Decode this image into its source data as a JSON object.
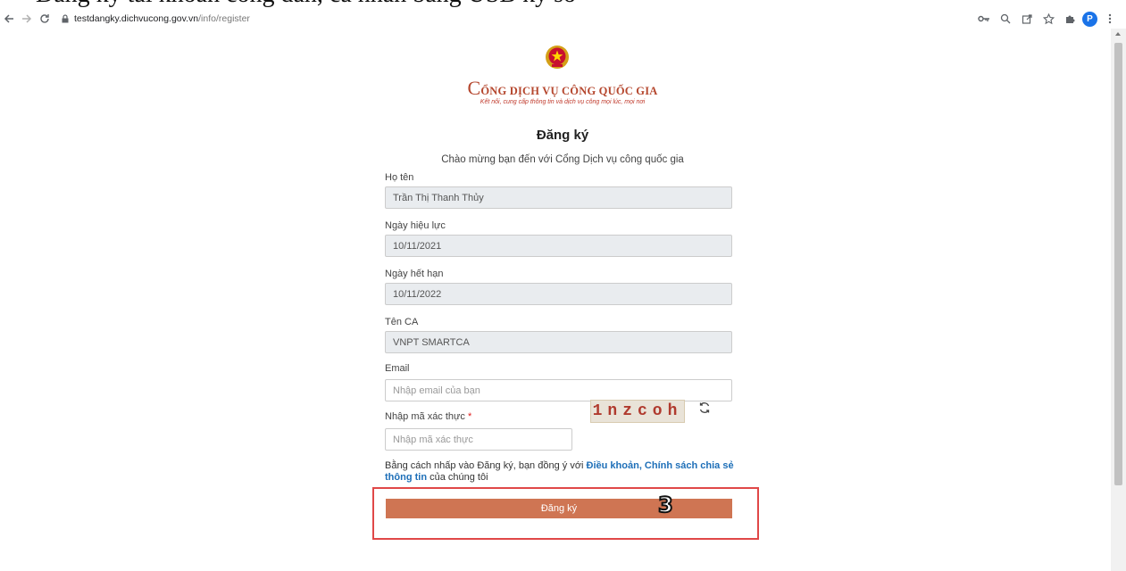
{
  "browser": {
    "url_host": "testdangky.dichvucong.gov.vn",
    "url_path": "/info/register",
    "profile_initial": "P"
  },
  "top_strip_text": "Đăng ký tài khoản công dân, cá nhân bằng USB ký số",
  "brand": {
    "title_initial": "C",
    "title_rest": "ỔNG DỊCH VỤ CÔNG QUỐC GIA",
    "tagline": "Kết nối, cung cấp thông tin và dịch vụ công mọi lúc, mọi nơi"
  },
  "form": {
    "title": "Đăng ký",
    "welcome": "Chào mừng bạn đến với Cổng Dịch vụ công quốc gia",
    "fields": [
      {
        "label": "Họ tên",
        "value": "Trần Thị Thanh Thủy"
      },
      {
        "label": "Ngày hiệu lực",
        "value": "10/11/2021"
      },
      {
        "label": "Ngày hết hạn",
        "value": "10/11/2022"
      },
      {
        "label": "Tên CA",
        "value": "VNPT SMARTCA"
      }
    ],
    "email": {
      "label": "Email",
      "placeholder": "Nhập email của bạn"
    },
    "captcha": {
      "label": "Nhập mã xác thực",
      "required_mark": "*",
      "placeholder": "Nhập mã xác thực",
      "code": "1nzcoh"
    },
    "terms": {
      "prefix": "Bằng cách nhấp vào Đăng ký, bạn đồng ý với ",
      "link": "Điều khoản, Chính sách chia sẻ thông tin",
      "suffix": " của chúng tôi"
    },
    "submit_label": "Đăng ký"
  },
  "annotation": {
    "step": "3",
    "color": "#e04848"
  },
  "colors": {
    "brand": "#b5472e",
    "button": "#cf7553",
    "link": "#1e6fb8"
  }
}
